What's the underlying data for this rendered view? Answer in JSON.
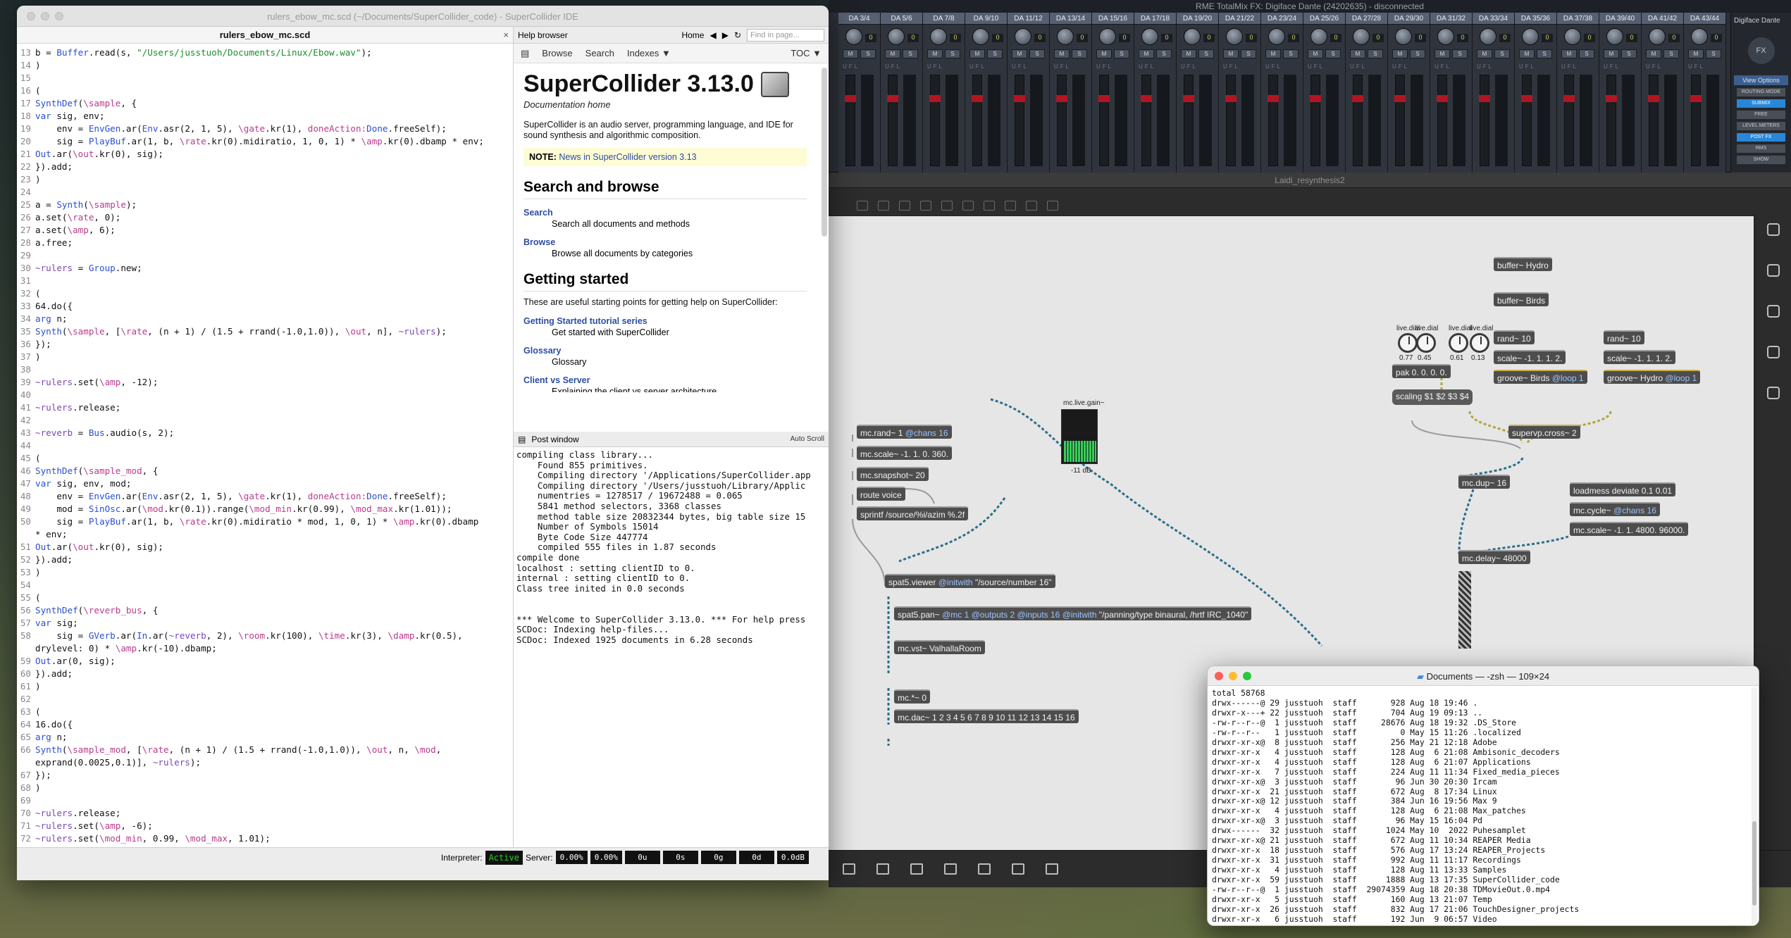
{
  "rme": {
    "title": "RME TotalMix FX: Digiface Dante (24202635) - disconnected",
    "channels": [
      "DA 3/4",
      "DA 5/6",
      "DA 7/8",
      "DA 9/10",
      "DA 11/12",
      "DA 13/14",
      "DA 15/16",
      "DA 17/18",
      "DA 19/20",
      "DA 21/22",
      "DA 23/24",
      "DA 25/26",
      "DA 27/28",
      "DA 29/30",
      "DA 31/32",
      "DA 33/34",
      "DA 35/36",
      "DA 37/38",
      "DA 39/40",
      "DA 41/42",
      "DA 43/44"
    ],
    "knob_value": "0",
    "mute": "M",
    "solo": "S",
    "ufl": "UFL",
    "dante_label": "Digiface Dante",
    "fx": "FX",
    "view_options": "View Options",
    "routing": "ROUTING MODE",
    "submix": "SUBMIX",
    "free": "FREE",
    "level": "LEVEL METERS",
    "postfx": "POST FX",
    "rms": "RMS",
    "show": "SHOW"
  },
  "max": {
    "title": "Laidi_resynthesis2",
    "objects": {
      "buffer_hydro": "buffer~ Hydro",
      "buffer_birds": "buffer~ Birds",
      "rand1": "rand~ 10",
      "rand2": "rand~ 10",
      "scale1": "scale~ -1. 1. 1. 2.",
      "scale2": "scale~ -1. 1. 1. 2.",
      "groove_birds": "groove~ Birds",
      "groove_birds_attr": "@loop 1",
      "groove_hydro": "groove~ Hydro",
      "groove_hydro_attr": "@loop 1",
      "pak": "pak 0. 0. 0. 0.",
      "scaling": "scaling $1 $2 $3 $4",
      "supervp": "supervp.cross~ 2",
      "mcrand": "mc.rand~ 1",
      "mcrand_attr": "@chans 16",
      "mcscale": "mc.scale~ -1. 1. 0. 360.",
      "mcsnap": "mc.snapshot~ 20",
      "route": "route voice",
      "sprintf": "sprintf /source/%i/azim %.2f",
      "mcdup": "mc.dup~ 16",
      "loadmess": "loadmess deviate 0.1 0.01",
      "mccycle": "mc.cycle~",
      "mccycle_attr": "@chans 16",
      "mcscale2": "mc.scale~ -1. 1. 4800. 96000.",
      "mcdelay": "mc.delay~ 48000",
      "viewer": "spat5.viewer",
      "viewer_attr": "@initwith",
      "viewer_arg": "\"/source/number 16\"",
      "pan": "spat5.pan~",
      "pan_attr": "@mc 1 @outputs 2 @inputs 16 @initwith",
      "pan_arg": "\"/panning/type binaural, /hrtf IRC_1040\"",
      "vst": "mc.vst~ ValhallaRoom",
      "mcmul": "mc.*~ 0",
      "dac": "mc.dac~ 1 2 3 4 5 6 7 8 9 10 11 12 13 14 15 16",
      "gain_label": "mc.live.gain~",
      "gain_db": "-11 dB",
      "dial_label": "live.dial",
      "dial_values": [
        "0.77",
        "0.45",
        "0.61",
        "0.13"
      ]
    }
  },
  "ide": {
    "title": "rulers_ebow_mc.scd (~/Documents/SuperCollider_code) - SuperCollider IDE",
    "tab": "rulers_ebow_mc.scd",
    "close": "×",
    "status": {
      "interpreter_label": "Interpreter:",
      "interpreter_state": "Active",
      "server_label": "Server:",
      "cpu_avg": "0.00%",
      "cpu_peak": "0.00%",
      "ugens": "0u",
      "synths": "0s",
      "groups": "0g",
      "defs": "0d",
      "volume": "0.0dB"
    }
  },
  "help": {
    "title": "Help browser",
    "home": "Home",
    "find_placeholder": "Find in page...",
    "nav": [
      "Browse",
      "Search",
      "Indexes ▼"
    ],
    "toc": "TOC ▼",
    "heading": "SuperCollider 3.13.0",
    "subheading": "Documentation home",
    "intro": "SuperCollider is an audio server, programming language, and IDE for sound synthesis and algorithmic composition.",
    "note_label": "NOTE:",
    "note_link": "News in SuperCollider version 3.13",
    "sec1": "Search and browse",
    "search_t": "Search",
    "search_d": "Search all documents and methods",
    "browse_t": "Browse",
    "browse_d": "Browse all documents by categories",
    "sec2": "Getting started",
    "gs_intro": "These are useful starting points for getting help on SuperCollider:",
    "gst_t": "Getting Started tutorial series",
    "gst_d": "Get started with SuperCollider",
    "glossary_t": "Glossary",
    "glossary_d": "Glossary",
    "cvs_t": "Client vs Server",
    "cvs_d": "Explaining the client vs server architecture"
  },
  "post": {
    "title": "Post window",
    "autoscroll": "Auto Scroll",
    "lines": [
      "compiling class library...",
      "    Found 855 primitives.",
      "    Compiling directory '/Applications/SuperCollider.app",
      "    Compiling directory '/Users/jusstuoh/Library/Applic",
      "    numentries = 1278517 / 19672488 = 0.065",
      "    5841 method selectors, 3368 classes",
      "    method table size 20832344 bytes, big table size 15",
      "    Number of Symbols 15014",
      "    Byte Code Size 447774",
      "    compiled 555 files in 1.87 seconds",
      "compile done",
      "localhost : setting clientID to 0.",
      "internal : setting clientID to 0.",
      "Class tree inited in 0.0 seconds",
      "",
      "",
      "*** Welcome to SuperCollider 3.13.0. *** For help press",
      "SCDoc: Indexing help-files...",
      "SCDoc: Indexed 1925 documents in 6.28 seconds"
    ]
  },
  "terminal": {
    "title": "Documents — -zsh — 109×24",
    "lines": [
      "total 58768",
      "drwx------@ 29 jusstuoh  staff       928 Aug 18 19:46 .",
      "drwxr-x---+ 22 jusstuoh  staff       704 Aug 19 09:13 ..",
      "-rw-r--r--@  1 jusstuoh  staff     28676 Aug 18 19:32 .DS_Store",
      "-rw-r--r--   1 jusstuoh  staff         0 May 15 11:26 .localized",
      "drwxr-xr-x@  8 jusstuoh  staff       256 May 21 12:18 Adobe",
      "drwxr-xr-x   4 jusstuoh  staff       128 Aug  6 21:08 Ambisonic_decoders",
      "drwxr-xr-x   4 jusstuoh  staff       128 Aug  6 21:07 Applications",
      "drwxr-xr-x   7 jusstuoh  staff       224 Aug 11 11:34 Fixed_media_pieces",
      "drwxr-xr-x@  3 jusstuoh  staff        96 Jun 30 20:30 Ircam",
      "drwxr-xr-x  21 jusstuoh  staff       672 Aug  8 17:34 Linux",
      "drwxr-xr-x@ 12 jusstuoh  staff       384 Jun 16 19:56 Max 9",
      "drwxr-xr-x   4 jusstuoh  staff       128 Aug  6 21:08 Max_patches",
      "drwxr-xr-x@  3 jusstuoh  staff        96 May 15 16:04 Pd",
      "drwx------  32 jusstuoh  staff      1024 May 10  2022 Puhesamplet",
      "drwxr-xr-x@ 21 jusstuoh  staff       672 Aug 11 10:34 REAPER Media",
      "drwxr-xr-x  18 jusstuoh  staff       576 Aug 17 13:24 REAPER_Projects",
      "drwxr-xr-x  31 jusstuoh  staff       992 Aug 11 11:17 Recordings",
      "drwxr-xr-x   4 jusstuoh  staff       128 Aug 11 13:33 Samples",
      "drwxr-xr-x  59 jusstuoh  staff      1888 Aug 13 17:35 SuperCollider_code",
      "-rw-r--r--@  1 jusstuoh  staff  29074359 Aug 18 20:38 TDMovieOut.0.mp4",
      "drwxr-xr-x   5 jusstuoh  staff       160 Aug 13 21:07 Temp",
      "drwxr-xr-x  26 jusstuoh  staff       832 Aug 17 21:06 TouchDesigner_projects",
      "drwxr-xr-x   6 jusstuoh  staff       192 Jun  9 06:57 Video"
    ]
  },
  "colors": {
    "active": "#21d021",
    "link": "#2b4da3",
    "patch_cord": "#2a6f8a"
  }
}
